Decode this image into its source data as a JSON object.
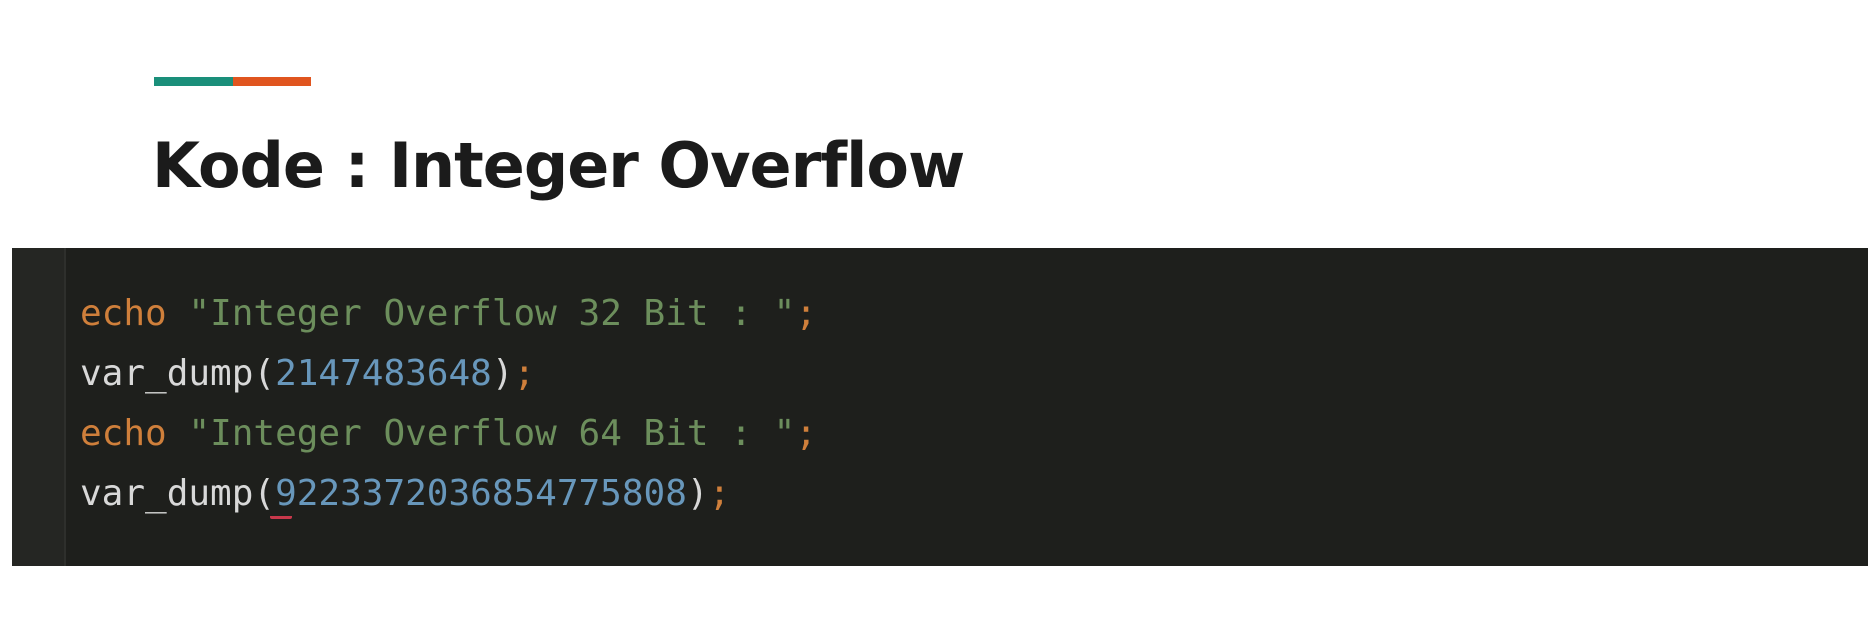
{
  "slide": {
    "title": "Kode : Integer Overflow",
    "accent_colors": [
      "#1a8f7a",
      "#e0551f"
    ]
  },
  "code": {
    "language": "php",
    "lines": [
      {
        "kw": "echo",
        "str": "\"Integer Overflow 32 Bit : \"",
        "semi": ";"
      },
      {
        "fn": "var_dump",
        "open": "(",
        "num": "2147483648",
        "close": ")",
        "semi": ";"
      },
      {
        "kw": "echo",
        "str": "\"Integer Overflow 64 Bit : \"",
        "semi": ";"
      },
      {
        "fn": "var_dump",
        "open": "(",
        "num": "9223372036854775808",
        "close": ")",
        "semi": ";"
      }
    ],
    "colors": {
      "background": "#1e1f1c",
      "keyword": "#cf7f3b",
      "string": "#6c8e5c",
      "number": "#6897bb",
      "text": "#d8d8d8"
    }
  }
}
